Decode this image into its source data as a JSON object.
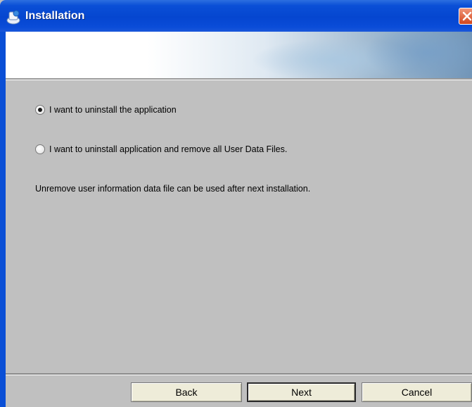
{
  "window": {
    "title": "Installation"
  },
  "options": [
    {
      "label": "I want to uninstall the application",
      "checked": true
    },
    {
      "label": "I want to uninstall application and remove all User Data Files.",
      "checked": false
    }
  ],
  "info": {
    "text": "Unremove user information data file can be used after next installation."
  },
  "buttons": {
    "back": "Back",
    "next": "Next",
    "cancel": "Cancel"
  },
  "colors": {
    "titlebar": "#0546d0",
    "dialog_background": "#c0c0c0",
    "button_face": "#eeecd9",
    "close_button": "#d2461c"
  }
}
